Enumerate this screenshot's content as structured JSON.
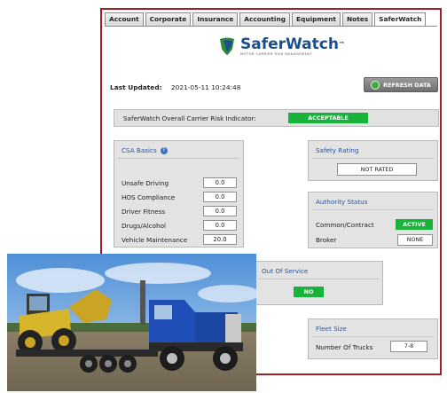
{
  "tabs": [
    "Account",
    "Corporate",
    "Insurance",
    "Accounting",
    "Equipment",
    "Notes",
    "SaferWatch"
  ],
  "active_tab": "SaferWatch",
  "logo": {
    "name": "SaferWatch",
    "trademark": "™",
    "tagline": "MOTOR CARRIER RISK MANAGEMENT"
  },
  "last_updated": {
    "label": "Last Updated:",
    "value": "2021-05-11 10:24:48"
  },
  "refresh_button": {
    "label": "REFRESH DATA",
    "icon": "refresh-icon"
  },
  "risk": {
    "label": "SaferWatch Overall Carrier Risk Indicator:",
    "value": "ACCEPTABLE"
  },
  "csa": {
    "title": "CSA Basics",
    "info_icon": "?",
    "rows": [
      {
        "name": "Unsafe Driving",
        "value": "0.0"
      },
      {
        "name": "HOS Compliance",
        "value": "0.0"
      },
      {
        "name": "Driver Fitness",
        "value": "0.0"
      },
      {
        "name": "Drugs/Alcohol",
        "value": "0.0"
      },
      {
        "name": "Vehicle Maintenance",
        "value": "20.0"
      }
    ]
  },
  "safety_rating": {
    "title": "Safety Rating",
    "value": "NOT RATED"
  },
  "authority": {
    "title": "Authority Status",
    "common": {
      "name": "Common/Contract",
      "value": "ACTIVE"
    },
    "broker": {
      "name": "Broker",
      "value": "NONE"
    }
  },
  "out_of_service": {
    "title": "Out Of Service",
    "value": "NO"
  },
  "fleet": {
    "title": "Fleet Size",
    "name": "Number Of Trucks",
    "value": "7-8"
  },
  "colors": {
    "accent_border": "#a01e24",
    "status_green": "#17b33b",
    "panel_title_blue": "#2257a8",
    "brand_blue": "#1a4f8a"
  }
}
